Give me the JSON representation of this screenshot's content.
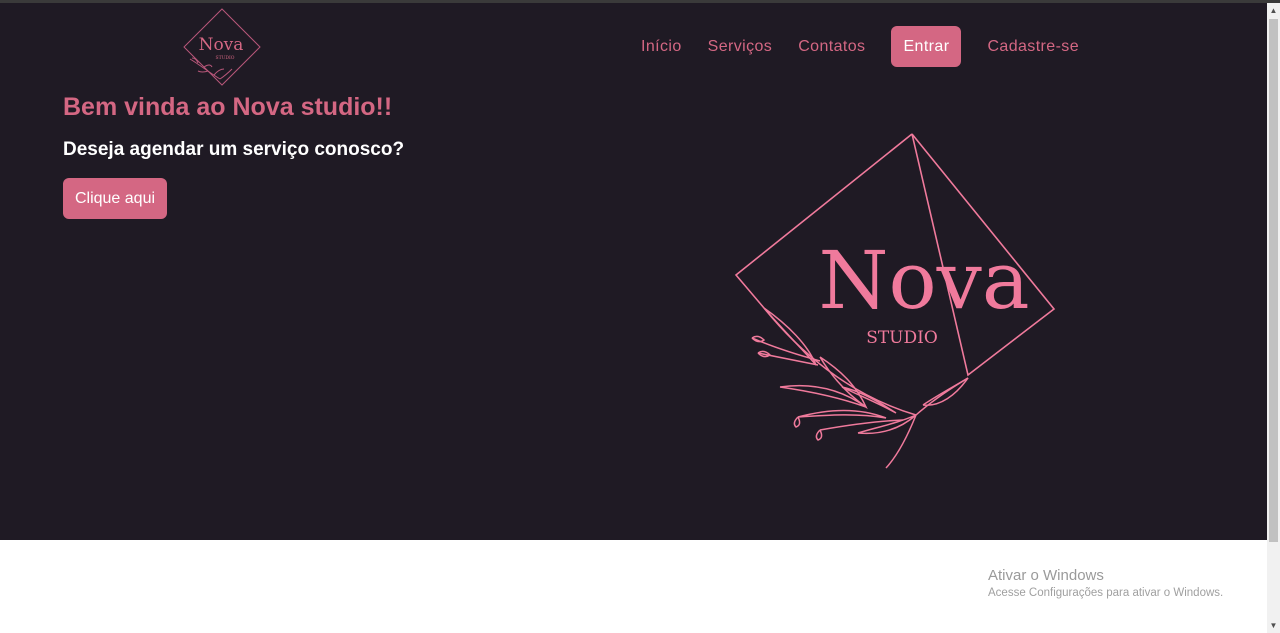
{
  "brand": {
    "name": "Nova",
    "tagline": "STUDIO",
    "color": "#d46783"
  },
  "nav": {
    "items": [
      "Início",
      "Serviços",
      "Contatos"
    ],
    "login": "Entrar",
    "signup": "Cadastre-se"
  },
  "hero": {
    "title": "Bem vinda ao Nova studio!!",
    "subtitle": "Deseja agendar um serviço conosco?",
    "cta": "Clique aqui",
    "background": "#1f1a24"
  },
  "windows_watermark": {
    "title": "Ativar o Windows",
    "subtitle": "Acesse Configurações para ativar o Windows."
  }
}
